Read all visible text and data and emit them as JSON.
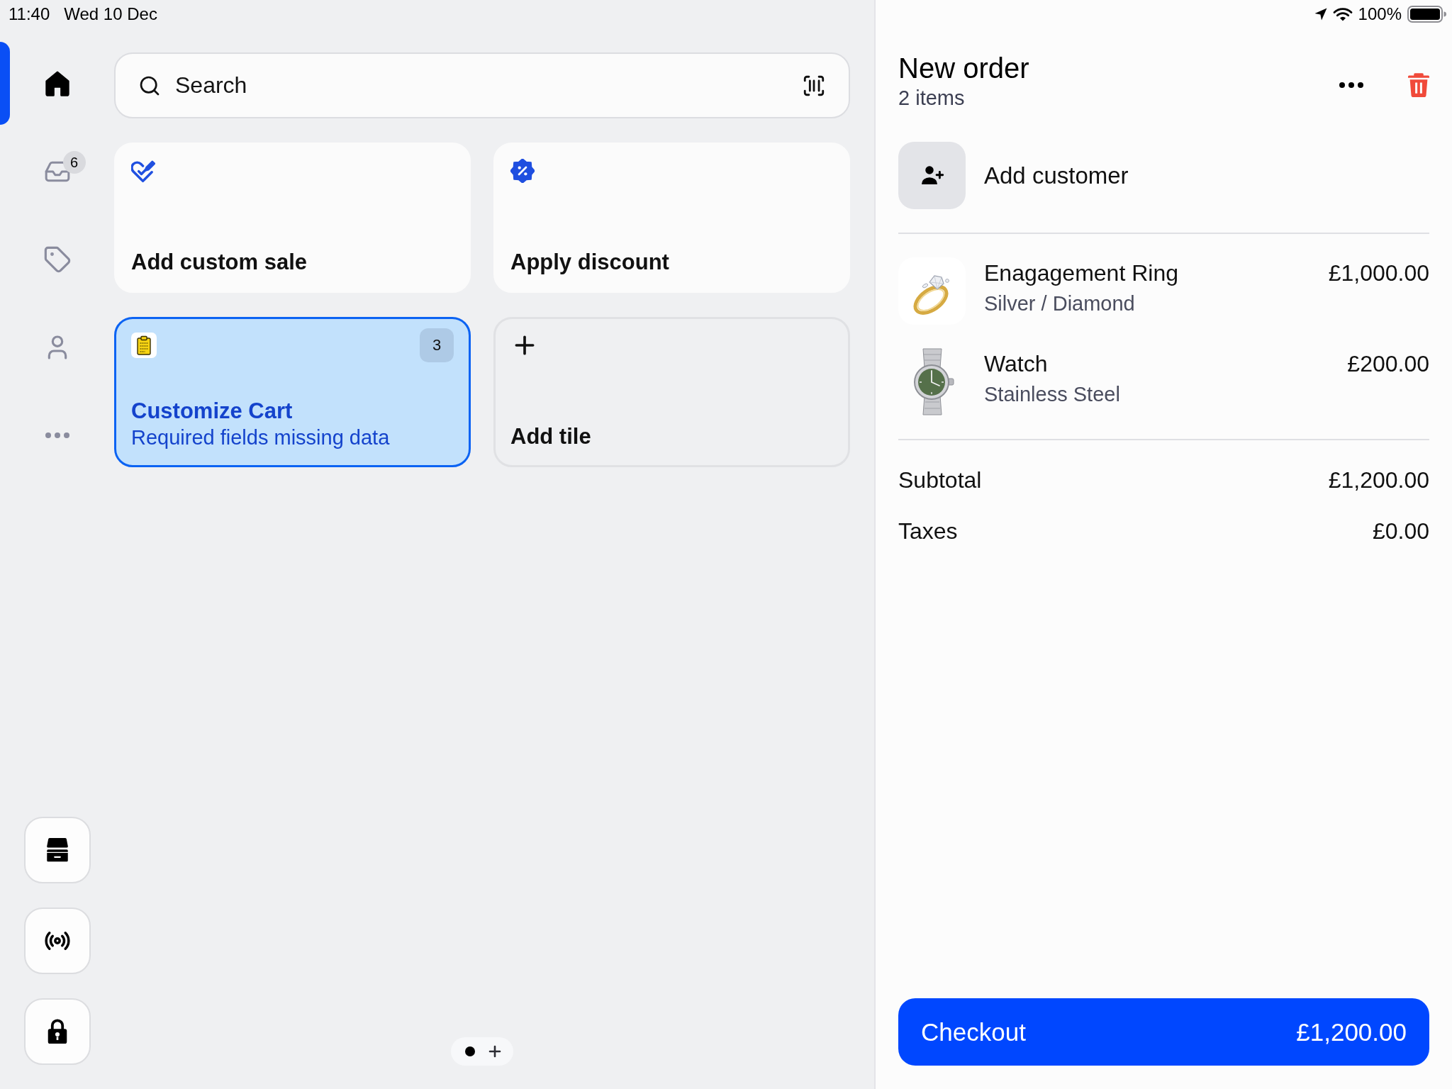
{
  "status_bar": {
    "time": "11:40",
    "date": "Wed 10 Dec",
    "battery": "100%"
  },
  "sidebar": {
    "items": [
      {
        "kind": "home",
        "selected": true
      },
      {
        "kind": "inbox",
        "selected": false,
        "badge": "6"
      },
      {
        "kind": "tag",
        "selected": false
      },
      {
        "kind": "person",
        "selected": false
      },
      {
        "kind": "more",
        "selected": false
      }
    ],
    "buttons": [
      {
        "kind": "store"
      },
      {
        "kind": "broadcast"
      },
      {
        "kind": "lock"
      }
    ]
  },
  "search": {
    "placeholder": "Search"
  },
  "tiles": [
    {
      "kind": "custom_sale",
      "title": "Add custom sale",
      "selected": false
    },
    {
      "kind": "discount",
      "title": "Apply discount",
      "selected": false
    },
    {
      "kind": "customize",
      "title": "Customize Cart",
      "subtitle": "Required fields missing data",
      "badge": "3",
      "selected": true
    },
    {
      "kind": "add",
      "title": "Add tile",
      "selected": false
    }
  ],
  "pager": {
    "pages": [
      {
        "selected": true
      }
    ]
  },
  "order": {
    "title": "New order",
    "count": "2 items",
    "customer": "Add customer",
    "items": [
      {
        "kind": "ring",
        "name": "Enagagement Ring",
        "variant": "Silver / Diamond",
        "price": "£1,000.00"
      },
      {
        "kind": "watch",
        "name": "Watch",
        "variant": "Stainless Steel",
        "price": "£200.00"
      }
    ],
    "totals": [
      {
        "label": "Subtotal",
        "value": "£1,200.00"
      },
      {
        "label": "Taxes",
        "value": "£0.00"
      }
    ],
    "checkout": {
      "label": "Checkout",
      "amount": "£1,200.00"
    }
  }
}
